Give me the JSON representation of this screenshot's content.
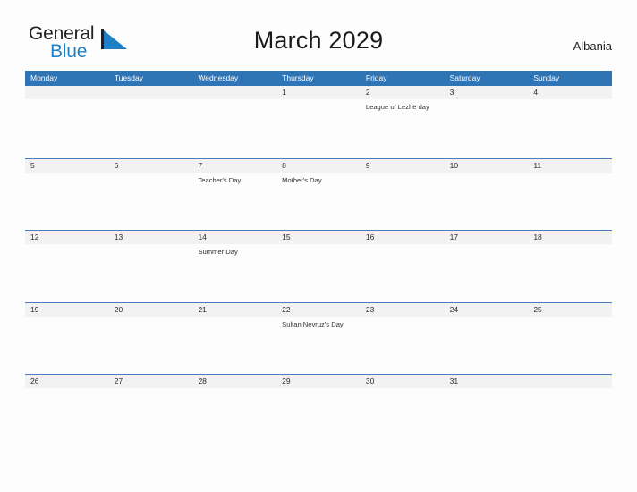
{
  "logo": {
    "word_one": "General",
    "word_two": "Blue",
    "flag_icon": "triangle-flag-icon",
    "color_dark": "#231f20",
    "color_blue": "#1f7fc4"
  },
  "header": {
    "title": "March 2029",
    "country": "Albania"
  },
  "colors": {
    "header_band": "#2f74b5",
    "row_divider": "#4a7ebb",
    "number_strip": "#f2f2f2",
    "page_background": "#fdfdfd",
    "event_text": "#333333"
  },
  "calendar": {
    "weekdays": [
      "Monday",
      "Tuesday",
      "Wednesday",
      "Thursday",
      "Friday",
      "Saturday",
      "Sunday"
    ],
    "weeks": [
      {
        "days": [
          {
            "number": "",
            "event": ""
          },
          {
            "number": "",
            "event": ""
          },
          {
            "number": "",
            "event": ""
          },
          {
            "number": "1",
            "event": ""
          },
          {
            "number": "2",
            "event": "League of Lezhë day"
          },
          {
            "number": "3",
            "event": ""
          },
          {
            "number": "4",
            "event": ""
          }
        ]
      },
      {
        "days": [
          {
            "number": "5",
            "event": ""
          },
          {
            "number": "6",
            "event": ""
          },
          {
            "number": "7",
            "event": "Teacher's Day"
          },
          {
            "number": "8",
            "event": "Mother's Day"
          },
          {
            "number": "9",
            "event": ""
          },
          {
            "number": "10",
            "event": ""
          },
          {
            "number": "11",
            "event": ""
          }
        ]
      },
      {
        "days": [
          {
            "number": "12",
            "event": ""
          },
          {
            "number": "13",
            "event": ""
          },
          {
            "number": "14",
            "event": "Summer Day"
          },
          {
            "number": "15",
            "event": ""
          },
          {
            "number": "16",
            "event": ""
          },
          {
            "number": "17",
            "event": ""
          },
          {
            "number": "18",
            "event": ""
          }
        ]
      },
      {
        "days": [
          {
            "number": "19",
            "event": ""
          },
          {
            "number": "20",
            "event": ""
          },
          {
            "number": "21",
            "event": ""
          },
          {
            "number": "22",
            "event": "Sultan Nevruz's Day"
          },
          {
            "number": "23",
            "event": ""
          },
          {
            "number": "24",
            "event": ""
          },
          {
            "number": "25",
            "event": ""
          }
        ]
      },
      {
        "days": [
          {
            "number": "26",
            "event": ""
          },
          {
            "number": "27",
            "event": ""
          },
          {
            "number": "28",
            "event": ""
          },
          {
            "number": "29",
            "event": ""
          },
          {
            "number": "30",
            "event": ""
          },
          {
            "number": "31",
            "event": ""
          },
          {
            "number": "",
            "event": ""
          }
        ]
      }
    ]
  }
}
